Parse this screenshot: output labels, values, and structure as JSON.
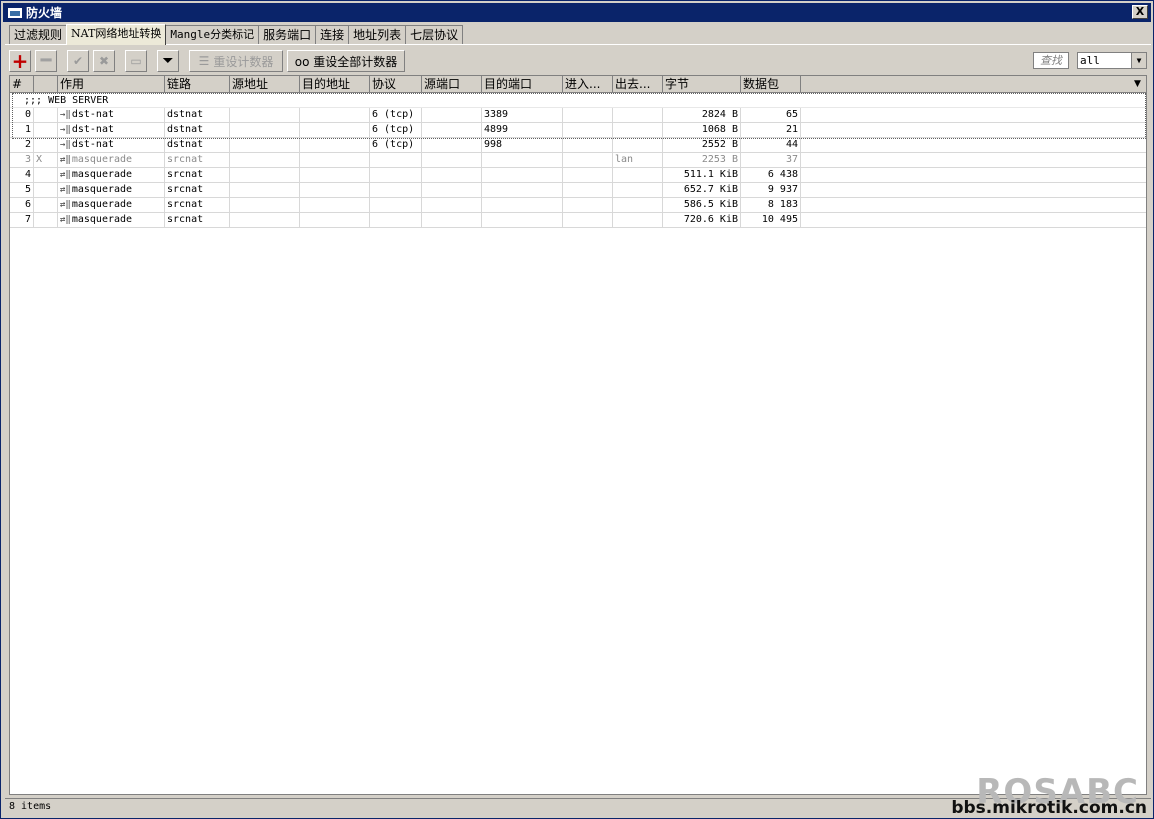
{
  "window": {
    "title": "防火墙",
    "close_label": "X"
  },
  "tabs": [
    {
      "label": "过滤规则"
    },
    {
      "label": "NAT网络地址转换"
    },
    {
      "label": "Mangle分类标记"
    },
    {
      "label": "服务端口"
    },
    {
      "label": "连接"
    },
    {
      "label": "地址列表"
    },
    {
      "label": "七层协议"
    }
  ],
  "toolbar": {
    "reset_counters_label": "重设计数器",
    "reset_all_counters_label": "oo 重设全部计数器",
    "find_placeholder": "查找",
    "filter_value": "all"
  },
  "table": {
    "columns": [
      "#",
      "",
      "作用",
      "链路",
      "源地址",
      "目的地址",
      "协议",
      "源端口",
      "目的端口",
      "进入...",
      "出去...",
      "字节",
      "数据包"
    ],
    "comment": ";;; WEB SERVER",
    "rows": [
      {
        "num": "0",
        "flag": "",
        "action": "dst-nat",
        "chain": "dstnat",
        "proto": "6 (tcp)",
        "dst_port": "3389",
        "out": "",
        "bytes": "2824 B",
        "packets": "65"
      },
      {
        "num": "1",
        "flag": "",
        "action": "dst-nat",
        "chain": "dstnat",
        "proto": "6 (tcp)",
        "dst_port": "4899",
        "out": "",
        "bytes": "1068 B",
        "packets": "21"
      },
      {
        "num": "2",
        "flag": "",
        "action": "dst-nat",
        "chain": "dstnat",
        "proto": "6 (tcp)",
        "dst_port": "998",
        "out": "",
        "bytes": "2552 B",
        "packets": "44"
      },
      {
        "num": "3",
        "flag": "X",
        "action": "masquerade",
        "chain": "srcnat",
        "proto": "",
        "dst_port": "",
        "out": "lan",
        "bytes": "2253 B",
        "packets": "37"
      },
      {
        "num": "4",
        "flag": "",
        "action": "masquerade",
        "chain": "srcnat",
        "proto": "",
        "dst_port": "",
        "out": "",
        "bytes": "511.1 KiB",
        "packets": "6 438"
      },
      {
        "num": "5",
        "flag": "",
        "action": "masquerade",
        "chain": "srcnat",
        "proto": "",
        "dst_port": "",
        "out": "",
        "bytes": "652.7 KiB",
        "packets": "9 937"
      },
      {
        "num": "6",
        "flag": "",
        "action": "masquerade",
        "chain": "srcnat",
        "proto": "",
        "dst_port": "",
        "out": "",
        "bytes": "586.5 KiB",
        "packets": "8 183"
      },
      {
        "num": "7",
        "flag": "",
        "action": "masquerade",
        "chain": "srcnat",
        "proto": "",
        "dst_port": "",
        "out": "",
        "bytes": "720.6 KiB",
        "packets": "10 495"
      }
    ]
  },
  "status": {
    "count_text": "8 items"
  },
  "watermark": {
    "big": "ROSABC",
    "small": "bbs.mikrotik.com.cn"
  },
  "colors": {
    "title_bar": "#0a246a",
    "add_icon": "#c00000",
    "window_bg": "#d4d0c8"
  }
}
